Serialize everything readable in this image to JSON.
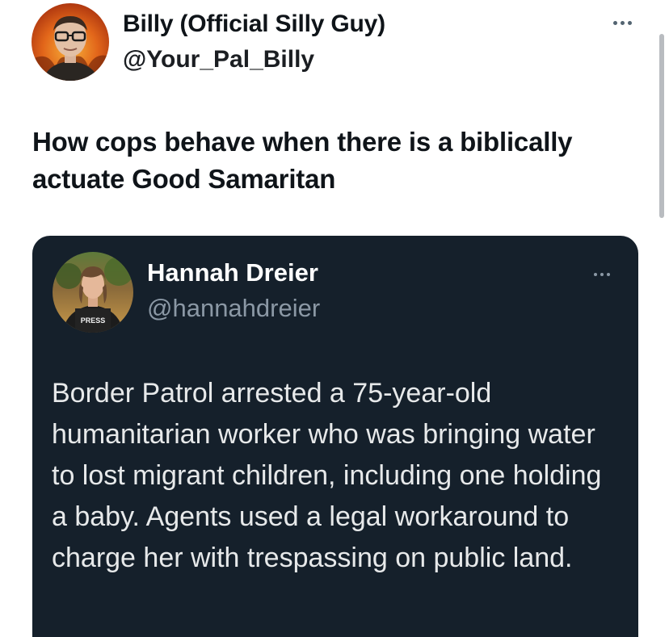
{
  "author": {
    "display_name": "Billy (Official Silly Guy)",
    "handle": "@Your_Pal_Billy",
    "avatar_icon": "profile-photo"
  },
  "tweet": {
    "text": "How cops behave when there is a biblically actuate Good Samaritan"
  },
  "quoted_tweet": {
    "display_name": "Hannah Dreier",
    "handle": "@hannahdreier",
    "avatar_vest_text": "PRESS",
    "text": "Border Patrol arrested a 75-year-old humanitarian worker who was bringing water to lost migrant children, including one holding a baby. Agents used a legal workaround to charge her with trespassing on public land."
  },
  "icons": {
    "more": "more-horizontal-icon"
  },
  "colors": {
    "quote_background": "#15202b",
    "quote_text": "#e7e9ea",
    "quote_secondary": "#8b98a5",
    "handle_text": "#1b1e22"
  }
}
